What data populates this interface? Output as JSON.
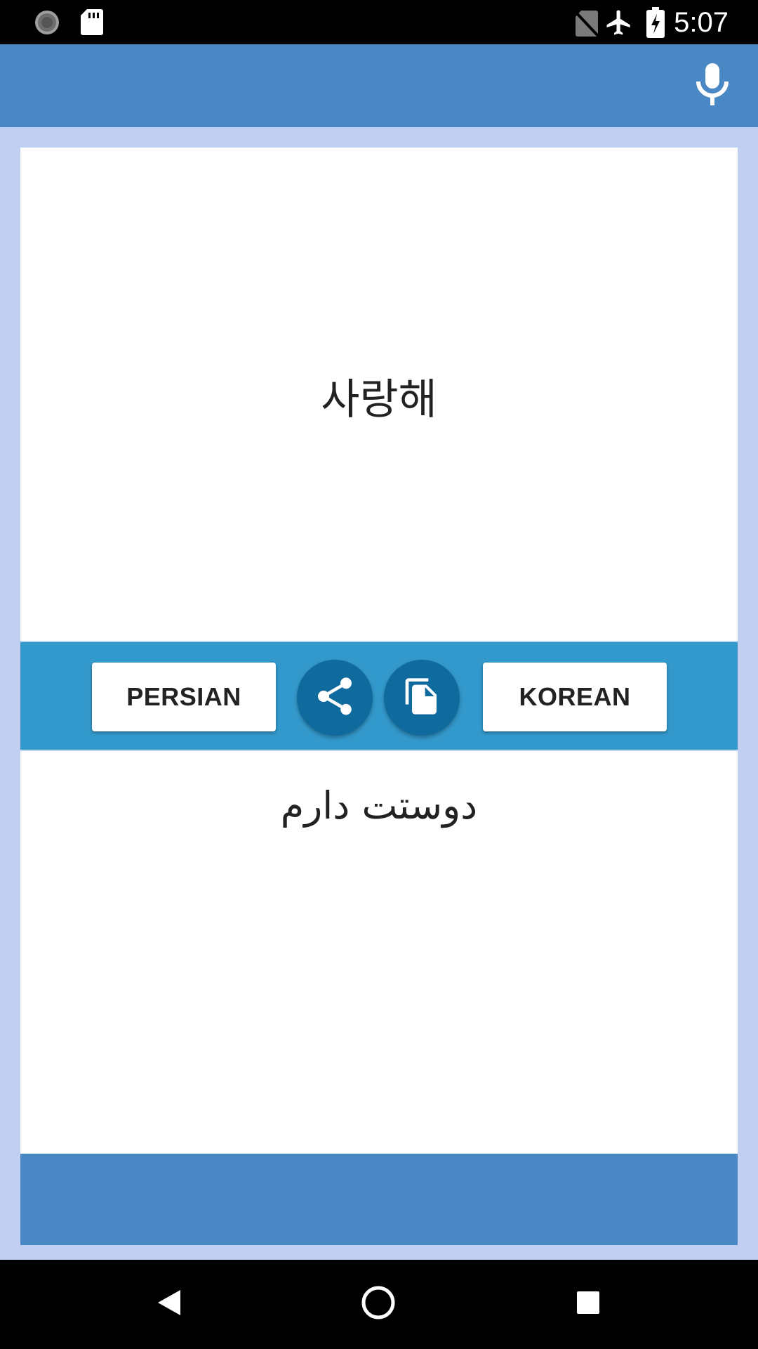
{
  "status_bar": {
    "time": "5:07",
    "icons": [
      "loading-spinner-icon",
      "sd-card-icon",
      "no-sim-icon",
      "airplane-mode-icon",
      "battery-charging-icon"
    ]
  },
  "app_bar": {
    "mic_icon": "mic-icon"
  },
  "translation": {
    "source_text": "사랑해",
    "target_text": "دوستت دارم"
  },
  "controls": {
    "source_language": "PERSIAN",
    "target_language": "KOREAN",
    "share_icon": "share-icon",
    "copy_icon": "copy-icon"
  },
  "navigation": {
    "back": "back-icon",
    "home": "home-icon",
    "recents": "recents-icon"
  },
  "colors": {
    "app_bar": "#4a87c5",
    "background": "#c1cff3",
    "control_bar": "#3399cc",
    "round_button": "#0f6a9d"
  }
}
